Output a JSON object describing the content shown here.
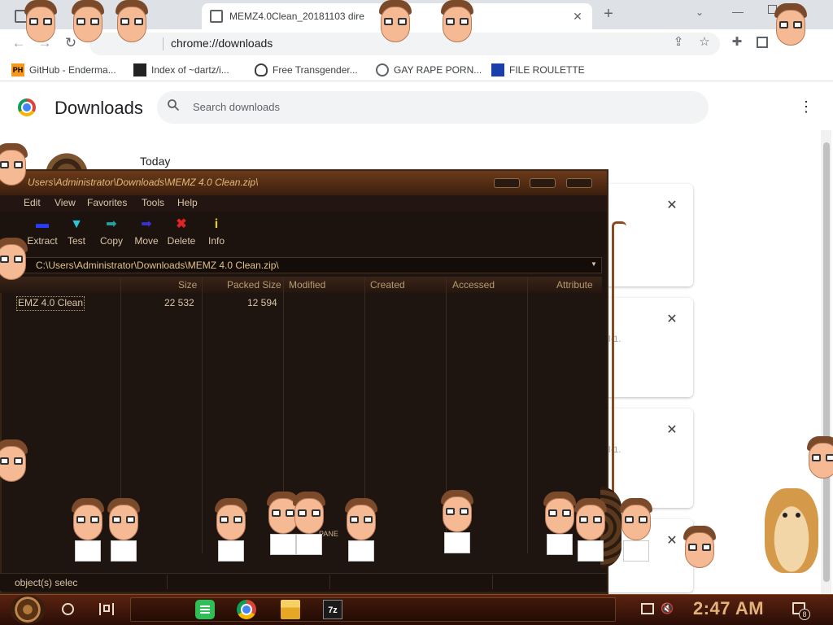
{
  "browser": {
    "tabs": [
      {
        "title": ""
      },
      {
        "title": "MEMZ4.0Clean_20181103 dire"
      }
    ],
    "address": "chrome://downloads",
    "bookmarks": [
      {
        "icon": "PH",
        "label": "GitHub - Enderma..."
      },
      {
        "icon": "",
        "label": "Index of ~dartz/i..."
      },
      {
        "icon": "",
        "label": "Free Transgender..."
      },
      {
        "icon": "",
        "label": "GAY RAPE PORN..."
      },
      {
        "icon": "",
        "label": "FILE ROULETTE"
      }
    ]
  },
  "downloads": {
    "title": "Downloads",
    "search_placeholder": "Search downloads",
    "section": "Today",
    "card_fragments": [
      "l-1.",
      "l-1."
    ]
  },
  "zip_window": {
    "title": "Users\\Administrator\\Downloads\\MEMZ 4.0 Clean.zip\\",
    "menu": [
      "Edit",
      "View",
      "Favorites",
      "Tools",
      "Help"
    ],
    "tools": [
      {
        "label": "Extract",
        "icon": "extract-icon",
        "color": "#2a3cff"
      },
      {
        "label": "Test",
        "icon": "test-icon",
        "color": "#29c6d8"
      },
      {
        "label": "Copy",
        "icon": "copy-icon",
        "color": "#1fa6a6"
      },
      {
        "label": "Move",
        "icon": "move-icon",
        "color": "#3a32d8"
      },
      {
        "label": "Delete",
        "icon": "delete-icon",
        "color": "#e02424"
      },
      {
        "label": "Info",
        "icon": "info-icon",
        "color": "#e8d21a"
      }
    ],
    "path": "C:\\Users\\Administrator\\Downloads\\MEMZ 4.0 Clean.zip\\",
    "columns": [
      "Size",
      "Packed Size",
      "Modified",
      "Created",
      "Accessed",
      "Attribute"
    ],
    "rows": [
      {
        "name": "EMZ 4.0 Clean",
        "size": "22 532",
        "packed": "12 594"
      }
    ],
    "status": "object(s) selec",
    "pane_label": "PANE"
  },
  "taskbar": {
    "time": "2:47 AM",
    "notification_count": "8",
    "apps": [
      "spotify-icon",
      "chrome-icon",
      "file-explorer-icon",
      "7zip-icon"
    ]
  },
  "colors": {
    "accent": "#e3b27a",
    "zip_text": "#d9c6a8",
    "zip_bg": "#1e1410"
  }
}
